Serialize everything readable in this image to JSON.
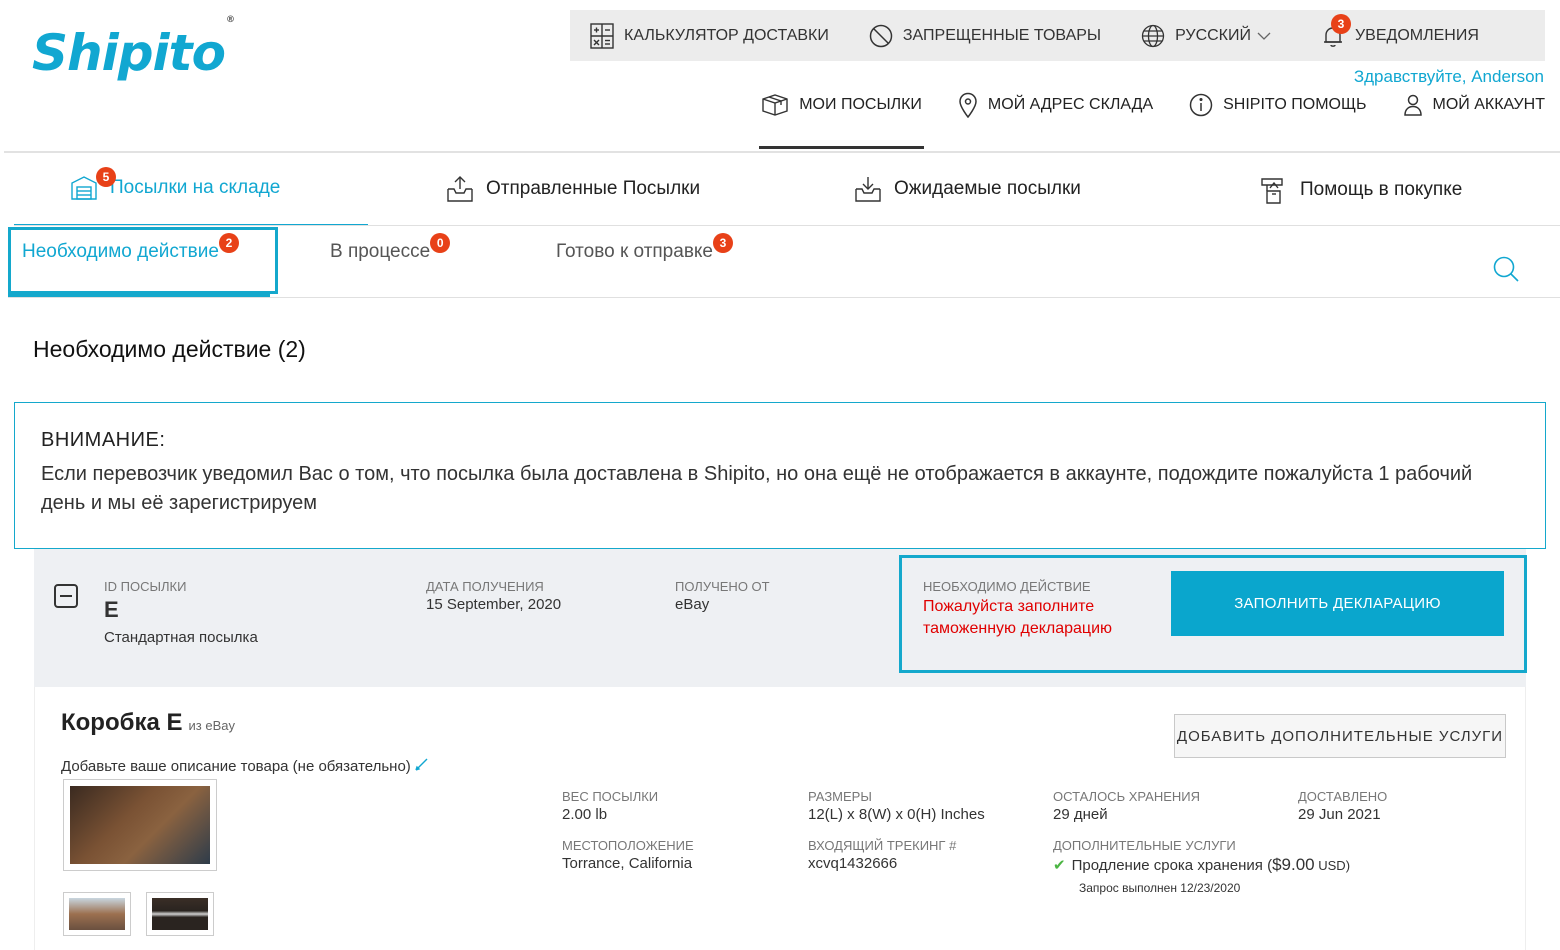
{
  "logo": {
    "text": "Shipito",
    "mark": "®"
  },
  "utility_bar": {
    "calculator": "КАЛЬКУЛЯТОР ДОСТАВКИ",
    "prohibited": "ЗАПРЕЩЕННЫЕ ТОВАРЫ",
    "language": "РУССКИЙ",
    "notifications": "УВЕДОМЛЕНИЯ",
    "notifications_count": "3"
  },
  "greeting": "Здравствуйте, Anderson",
  "main_nav": {
    "packages": "МОИ ПОСЫЛКИ",
    "warehouse": "МОЙ АДРЕС СКЛАДА",
    "help": "SHIPITO ПОМОЩЬ",
    "account": "МОЙ АККАУНТ"
  },
  "tabs": {
    "warehouse": "Посылки на складе",
    "warehouse_count": "5",
    "sent": "Отправленные Посылки",
    "expected": "Ожидаемые посылки",
    "purchase": "Помощь в покупке"
  },
  "subtabs": {
    "action": "Необходимо действие",
    "action_count": "2",
    "progress": "В процессе",
    "progress_count": "0",
    "ready": "Готово к отправке",
    "ready_count": "3"
  },
  "section_title": "Необходимо действие (2)",
  "notice": {
    "title": "ВНИМАНИЕ:",
    "text": "Если перевозчик уведомил Вас о том, что посылка была доставлена в Shipito, но она ещё не отображается в аккаунте, подождите пожалуйста 1 рабочий день и мы её зарегистрируем"
  },
  "package": {
    "id_label": "ID ПОСЫЛКИ",
    "id": "E",
    "type": "Стандартная посылка",
    "date_label": "ДАТА ПОЛУЧЕНИЯ",
    "date": "15 September, 2020",
    "from_label": "ПОЛУЧЕНО ОТ",
    "from": "eBay",
    "action_label": "НЕОБХОДИМО ДЕЙСТВИЕ",
    "action_text": "Пожалуйста заполните таможенную декларацию",
    "declare_button": "ЗАПОЛНИТЬ ДЕКЛАРАЦИЮ"
  },
  "box": {
    "title": "Коробка E",
    "from": "из eBay",
    "add_services_button": "ДОБАВИТЬ ДОПОЛНИТЕЛЬНЫЕ УСЛУГИ",
    "description_link": "Добавьте ваше описание товара (не обязательно)",
    "weight_label": "ВЕС ПОСЫЛКИ",
    "weight": "2.00 lb",
    "location_label": "МЕСТОПОЛОЖЕНИЕ",
    "location": "Torrance, California",
    "dimensions_label": "РАЗМЕРЫ",
    "dimensions": "12(L) x 8(W) x 0(H) Inches",
    "tracking_label": "ВХОДЯЩИЙ ТРЕКИНГ #",
    "tracking": "xcvq1432666",
    "storage_label": "ОСТАЛОСЬ ХРАНЕНИЯ",
    "storage": "29 дней",
    "delivered_label": "ДОСТАВЛЕНО",
    "delivered": "29 Jun 2021",
    "extra_label": "ДОПОЛНИТЕЛЬНЫЕ УСЛУГИ",
    "extra_service": "Продление срока хранения (",
    "extra_price": "$9.00",
    "extra_currency": " USD)",
    "extra_status": "Запрос выполнен 12/23/2020"
  },
  "colors": {
    "accent": "#11a7d1",
    "badge": "#e84118",
    "alert": "#e00000"
  },
  "icons": [
    "calculator-icon",
    "prohibited-icon",
    "globe-icon",
    "bell-icon",
    "box-icon",
    "location-pin-icon",
    "info-icon",
    "user-icon",
    "warehouse-icon",
    "upload-box-icon",
    "download-box-icon",
    "shopping-help-icon",
    "search-icon",
    "collapse-icon",
    "pencil-icon",
    "check-icon"
  ]
}
